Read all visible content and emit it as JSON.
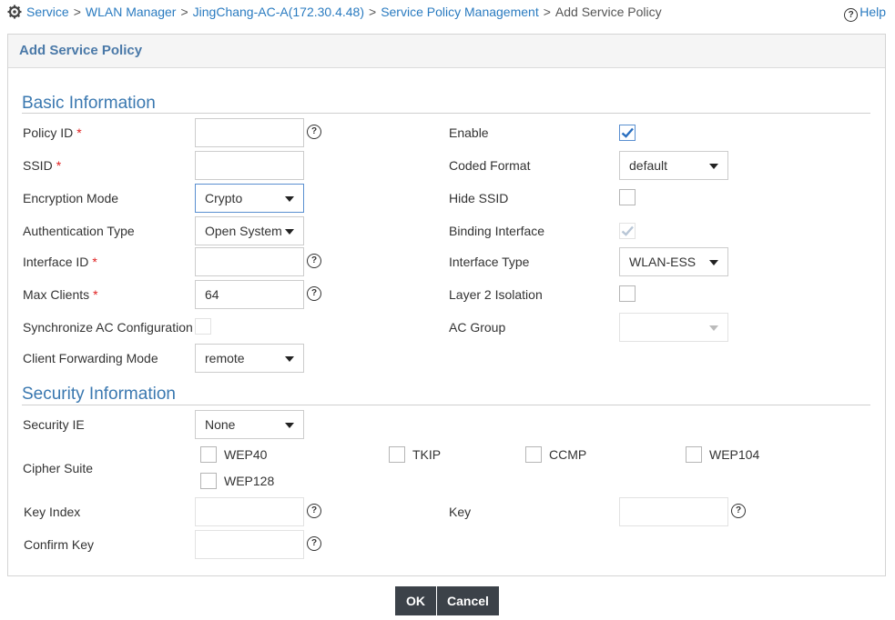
{
  "breadcrumb": {
    "items": [
      "Service",
      "WLAN Manager",
      "JingChang-AC-A(172.30.4.48)",
      "Service Policy Management"
    ],
    "current": "Add Service Policy",
    "separator": ">"
  },
  "help_label": "Help",
  "panel_title": "Add Service Policy",
  "basic": {
    "title": "Basic Information",
    "policy_id": {
      "label": "Policy ID",
      "value": ""
    },
    "ssid": {
      "label": "SSID",
      "value": ""
    },
    "encryption_mode": {
      "label": "Encryption Mode",
      "value": "Crypto"
    },
    "auth_type": {
      "label": "Authentication Type",
      "value": "Open System"
    },
    "interface_id": {
      "label": "Interface ID",
      "value": ""
    },
    "max_clients": {
      "label": "Max Clients",
      "value": "64"
    },
    "sync_ac": {
      "label": "Synchronize AC Configuration",
      "checked": false
    },
    "forwarding_mode": {
      "label": "Client Forwarding Mode",
      "value": "remote"
    },
    "enable": {
      "label": "Enable",
      "checked": true
    },
    "coded_format": {
      "label": "Coded Format",
      "value": "default"
    },
    "hide_ssid": {
      "label": "Hide SSID",
      "checked": false
    },
    "binding_interface": {
      "label": "Binding Interface",
      "checked": true,
      "disabled": true
    },
    "interface_type": {
      "label": "Interface Type",
      "value": "WLAN-ESS"
    },
    "layer2_isolation": {
      "label": "Layer 2 Isolation",
      "checked": false
    },
    "ac_group": {
      "label": "AC Group",
      "value": ""
    },
    "required_mark": "*"
  },
  "security": {
    "title": "Security Information",
    "security_ie": {
      "label": "Security IE",
      "value": "None"
    },
    "cipher_suite": {
      "label": "Cipher Suite",
      "options": [
        "WEP40",
        "TKIP",
        "CCMP",
        "WEP104",
        "WEP128"
      ]
    },
    "key_index": {
      "label": "Key Index",
      "value": ""
    },
    "key": {
      "label": "Key",
      "value": ""
    },
    "confirm_key": {
      "label": "Confirm Key",
      "value": ""
    }
  },
  "buttons": {
    "ok": "OK",
    "cancel": "Cancel"
  },
  "colors": {
    "link": "#2a7bc0",
    "section": "#3a78b0",
    "required": "#e02020",
    "button_bg": "#3c4249",
    "check": "#2a6fc0"
  },
  "icons": {
    "breadcrumb": "gear-icon",
    "help": "question-circle-icon",
    "checkmark": "check-icon"
  }
}
